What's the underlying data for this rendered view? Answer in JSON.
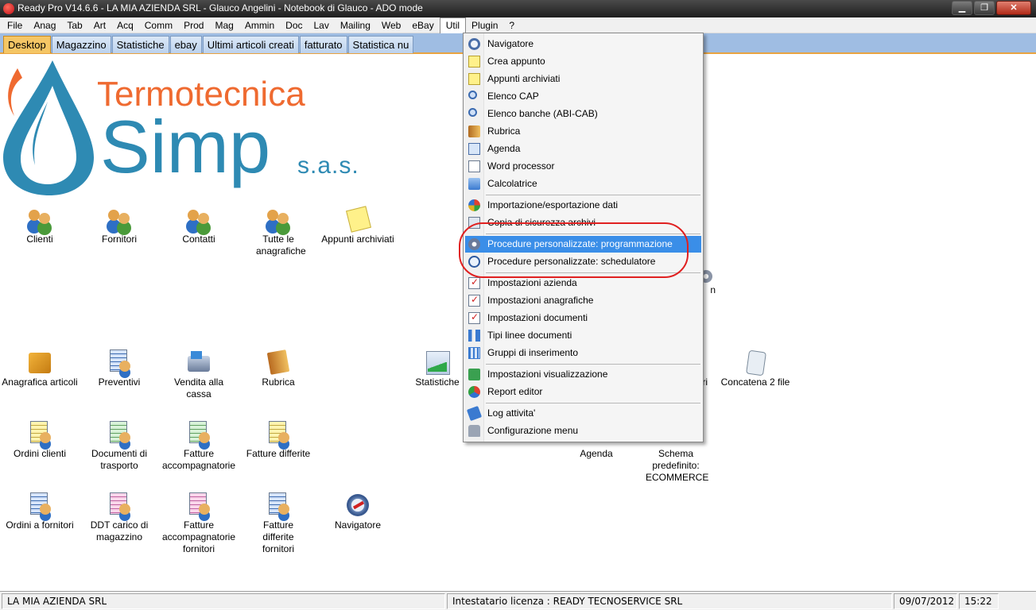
{
  "window": {
    "title": "Ready Pro V14.6.6 - LA MIA AZIENDA SRL - Glauco Angelini - Notebook di Glauco - ADO mode",
    "minimize": "▁",
    "maximize": "❐",
    "close": "✕"
  },
  "menubar": [
    "File",
    "Anag",
    "Tab",
    "Art",
    "Acq",
    "Comm",
    "Prod",
    "Mag",
    "Ammin",
    "Doc",
    "Lav",
    "Mailing",
    "Web",
    "eBay",
    "Util",
    "Plugin",
    "?"
  ],
  "menubar_active": "Util",
  "tabs": [
    "Desktop",
    "Magazzino",
    "Statistiche",
    "ebay",
    "Ultimi articoli creati",
    "fatturato",
    "Statistica nu"
  ],
  "active_tab": "Desktop",
  "logo": {
    "line1": "Termotecnica",
    "line2": "Simp",
    "line3": "s.a.s."
  },
  "desktop_icons": {
    "clienti": "Clienti",
    "fornitori": "Fornitori",
    "contatti": "Contatti",
    "tutte_le_anagrafiche": "Tutte le anagrafiche",
    "appunti_archiviati": "Appunti archiviati",
    "anagrafica_articoli": "Anagrafica articoli",
    "preventivi": "Preventivi",
    "vendita_alla_cassa": "Vendita alla cassa",
    "rubrica": "Rubrica",
    "statistiche": "Statistiche",
    "concatena_2_file": "Concatena 2 file",
    "ordini_clienti": "Ordini clienti",
    "documenti_di_trasporto": "Documenti di trasporto",
    "fatture_accompagnatorie": "Fatture accompagnatorie",
    "fatture_differite": "Fatture differite",
    "agenda": "Agenda",
    "schema_predefinito": "Schema predefinito: ECOMMERCE",
    "ordini_a_fornitori": "Ordini a fornitori",
    "ddt_carico": "DDT carico di magazzino",
    "fatture_acc_fornitori": "Fatture accompagnatorie fornitori",
    "fatture_diff_fornitori": "Fatture differite fornitori",
    "navigatore": "Navigatore",
    "partial_ri": "ri",
    "partial_n": "n"
  },
  "util_menu": [
    "Navigatore",
    "Crea appunto",
    "Appunti archiviati",
    "Elenco CAP",
    "Elenco banche (ABI-CAB)",
    "Rubrica",
    "Agenda",
    "Word processor",
    "Calcolatrice",
    "Importazione/esportazione dati",
    "Copia di sicurezza archivi",
    "Procedure personalizzate: programmazione",
    "Procedure personalizzate: schedulatore",
    "Impostazioni azienda",
    "Impostazioni anagrafiche",
    "Impostazioni documenti",
    "Tipi linee documenti",
    "Gruppi di inserimento",
    "Impostazioni visualizzazione",
    "Report editor",
    "Log attivita'",
    "Configurazione menu"
  ],
  "highlighted_menu_item": "Procedure personalizzate: programmazione",
  "statusbar": {
    "company": "LA MIA AZIENDA SRL",
    "license": "Intestatario licenza : READY TECNOSERVICE SRL",
    "date": "09/07/2012",
    "time": "15:22"
  },
  "colors": {
    "tab_bar": "#9fbde3",
    "active_tab": "#f5c665",
    "menu_highlight": "#3a8ee8",
    "annotation": "#e02020",
    "logo_orange": "#ef6a30",
    "logo_blue": "#2e8ab3"
  }
}
